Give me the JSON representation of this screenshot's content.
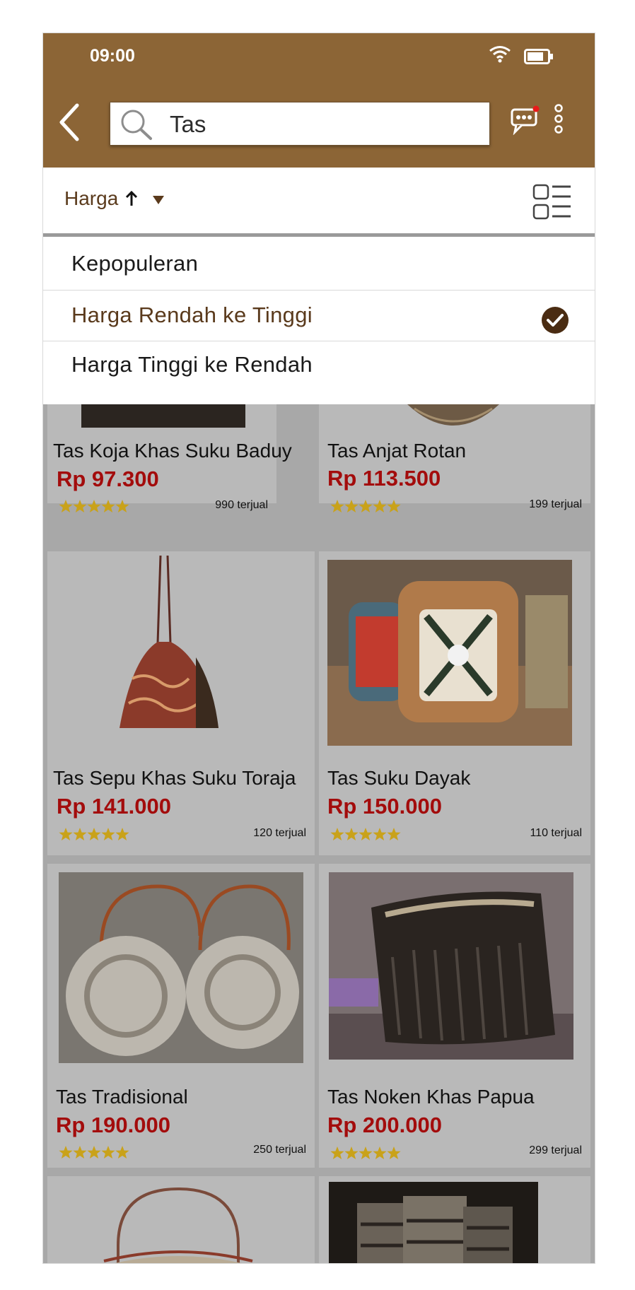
{
  "status_bar": {
    "time": "09:00"
  },
  "header": {
    "search_value": "Tas"
  },
  "sort": {
    "current_label": "Harga"
  },
  "sort_options": [
    {
      "label": "Kepopuleran",
      "selected": false
    },
    {
      "label": "Harga Rendah ke Tinggi",
      "selected": true
    },
    {
      "label": "Harga Tinggi ke Rendah",
      "selected": false
    }
  ],
  "products": [
    {
      "name": "Tas Koja Khas Suku Baduy",
      "price": "Rp 97.300",
      "sold": "990 terjual",
      "rating": 5
    },
    {
      "name": "Tas Anjat Rotan",
      "price": "Rp 113.500",
      "sold": "199 terjual",
      "rating": 5
    },
    {
      "name": "Tas Sepu Khas Suku Toraja",
      "price": "Rp 141.000",
      "sold": "120 terjual",
      "rating": 5
    },
    {
      "name": "Tas Suku Dayak",
      "price": "Rp 150.000",
      "sold": "110 terjual",
      "rating": 5
    },
    {
      "name": "Tas Tradisional",
      "price": "Rp 190.000",
      "sold": "250 terjual",
      "rating": 5
    },
    {
      "name": "Tas Noken Khas Papua",
      "price": "Rp 200.000",
      "sold": "299 terjual",
      "rating": 5
    }
  ],
  "colors": {
    "header": "#8c6536",
    "accent_brown": "#5a3a1c",
    "price_red": "#a30c0c",
    "star": "#c9a21a"
  },
  "icons": {
    "back": "chevron-left-icon",
    "search": "search-icon",
    "chat": "chat-bubble-icon",
    "more": "more-vertical-icon",
    "view": "list-view-icon",
    "check": "check-circle-icon",
    "sort_arrow": "arrow-up-icon",
    "caret": "caret-down-icon"
  }
}
